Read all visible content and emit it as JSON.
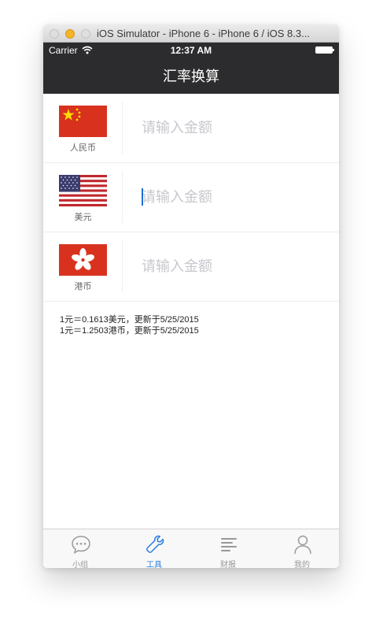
{
  "window": {
    "title": "iOS Simulator - iPhone 6 - iPhone 6 / iOS 8.3..."
  },
  "status_bar": {
    "carrier": "Carrier",
    "time": "12:37 AM"
  },
  "nav": {
    "title": "汇率换算"
  },
  "currencies": [
    {
      "name": "人民币",
      "placeholder": "请输入金额",
      "value": ""
    },
    {
      "name": "美元",
      "placeholder": "请输入金额",
      "value": ""
    },
    {
      "name": "港币",
      "placeholder": "请输入金额",
      "value": ""
    }
  ],
  "rates": [
    "1元＝0.1613美元，更新于5/25/2015",
    "1元＝1.2503港币，更新于5/25/2015"
  ],
  "tabs": [
    {
      "label": "小组",
      "icon": "chat-bubble-icon"
    },
    {
      "label": "工具",
      "icon": "wrench-icon"
    },
    {
      "label": "财报",
      "icon": "report-lines-icon"
    },
    {
      "label": "我的",
      "icon": "person-icon"
    }
  ],
  "active_tab": "工具",
  "colors": {
    "nav_background": "#2c2c2e",
    "accent": "#2a7ee0",
    "tab_inactive": "#999999"
  }
}
